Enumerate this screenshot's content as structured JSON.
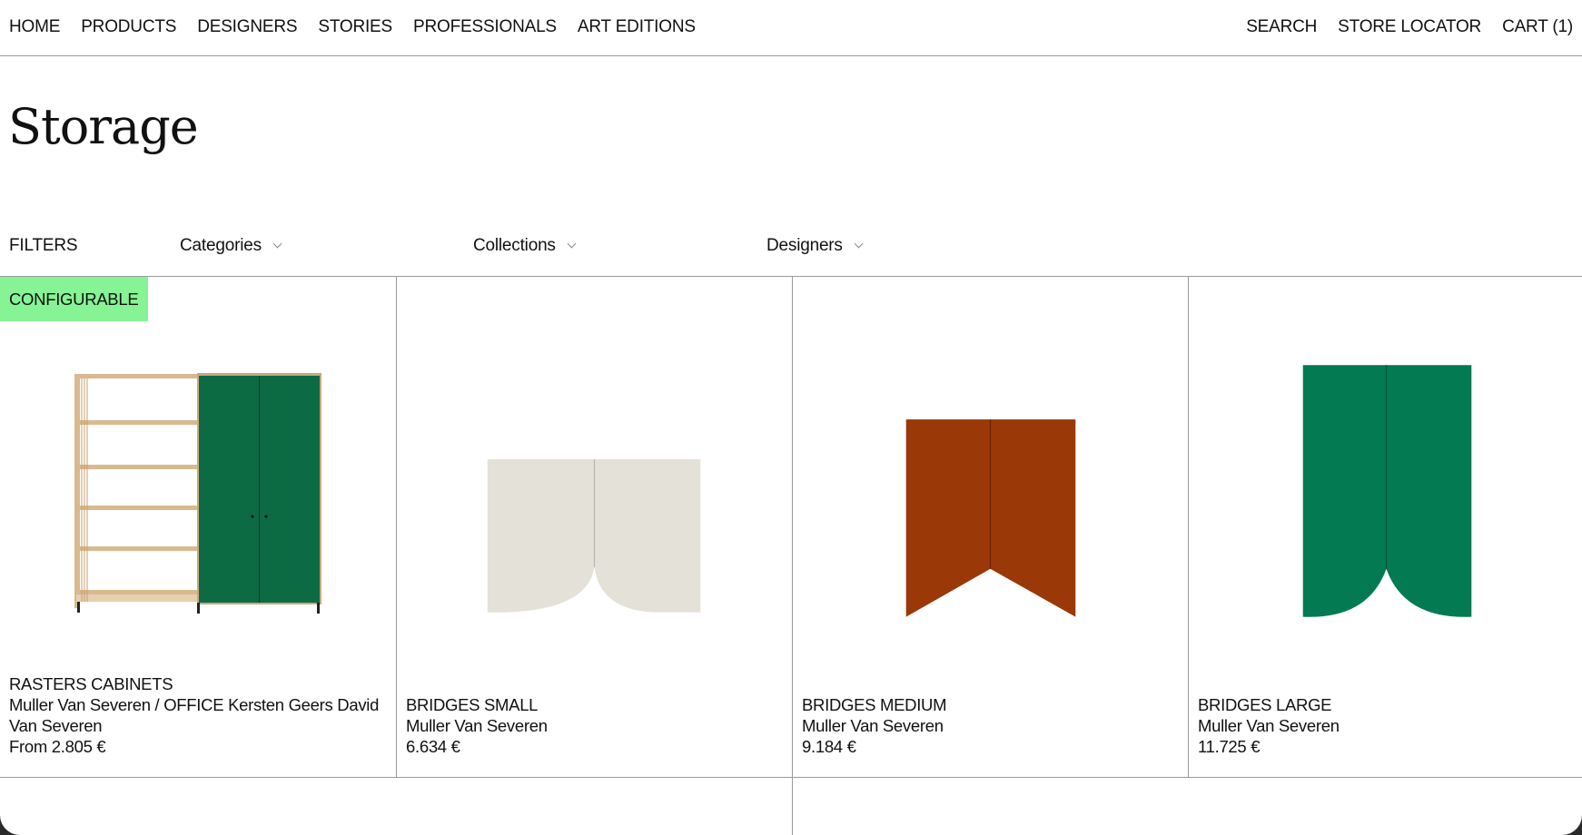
{
  "nav": {
    "left": [
      "HOME",
      "PRODUCTS",
      "DESIGNERS",
      "STORIES",
      "PROFESSIONALS",
      "ART EDITIONS"
    ],
    "right": [
      "SEARCH",
      "STORE LOCATOR",
      "CART (1)"
    ]
  },
  "page": {
    "title": "Storage"
  },
  "filters": {
    "label": "FILTERS",
    "dropdowns": [
      "Categories",
      "Collections",
      "Designers"
    ]
  },
  "products": [
    {
      "badge": "CONFIGURABLE",
      "name": "RASTERS CABINETS",
      "designer": "Muller Van Severen / OFFICE Kersten Geers David Van Severen",
      "price": "From 2.805 €",
      "colors": {
        "door": "#0d6b43",
        "wood": "#d9b98f"
      }
    },
    {
      "name": "BRIDGES SMALL",
      "designer": "Muller Van Severen",
      "price": "6.634 €",
      "colors": {
        "panel": "#e3e1d8"
      }
    },
    {
      "name": "BRIDGES MEDIUM",
      "designer": "Muller Van Severen",
      "price": "9.184 €",
      "colors": {
        "panel": "#9a3808"
      }
    },
    {
      "name": "BRIDGES LARGE",
      "designer": "Muller Van Severen",
      "price": "11.725 €",
      "colors": {
        "panel": "#037a52"
      }
    }
  ]
}
